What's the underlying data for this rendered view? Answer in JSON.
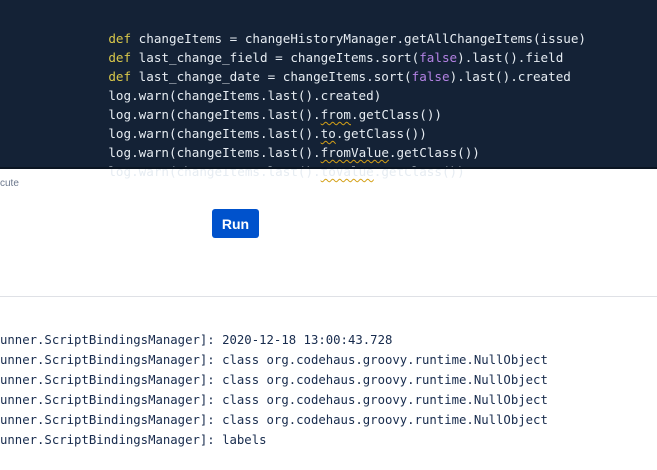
{
  "editor": {
    "lines": [
      [
        {
          "t": "def",
          "c": "kw"
        },
        {
          "t": " changeItems = changeHistoryManager.getAllChangeItems(issue)"
        }
      ],
      [
        {
          "t": "def",
          "c": "kw"
        },
        {
          "t": " last_change_field = changeItems.sort("
        },
        {
          "t": "false",
          "c": "lit"
        },
        {
          "t": ").last().field"
        }
      ],
      [
        {
          "t": "def",
          "c": "kw"
        },
        {
          "t": " last_change_date = changeItems.sort("
        },
        {
          "t": "false",
          "c": "lit"
        },
        {
          "t": ").last().created"
        }
      ],
      [
        {
          "t": "log.warn(changeItems.last().created)"
        }
      ],
      [
        {
          "t": "log.warn(changeItems.last()."
        },
        {
          "t": "from",
          "c": "squig"
        },
        {
          "t": ".getClass())"
        }
      ],
      [
        {
          "t": "log.warn(changeItems.last()."
        },
        {
          "t": "to",
          "c": "squig"
        },
        {
          "t": ".getClass())"
        }
      ],
      [
        {
          "t": "log.warn(changeItems.last()."
        },
        {
          "t": "fromValue",
          "c": "squig"
        },
        {
          "t": ".getClass())"
        }
      ],
      [
        {
          "t": "log.warn(changeItems.last()."
        },
        {
          "t": "toValue",
          "c": "squig"
        },
        {
          "t": ".getClass())"
        }
      ]
    ]
  },
  "hint": {
    "text": "cute"
  },
  "run_button": {
    "label": "Run"
  },
  "log": {
    "lines": [
      "unner.ScriptBindingsManager]: 2020-12-18 13:00:43.728",
      "unner.ScriptBindingsManager]: class org.codehaus.groovy.runtime.NullObject",
      "unner.ScriptBindingsManager]: class org.codehaus.groovy.runtime.NullObject",
      "unner.ScriptBindingsManager]: class org.codehaus.groovy.runtime.NullObject",
      "unner.ScriptBindingsManager]: class org.codehaus.groovy.runtime.NullObject",
      "unner.ScriptBindingsManager]: labels"
    ]
  },
  "colors": {
    "editor_background": "#142236",
    "keyword": "#d9c84a",
    "literal": "#b382e3",
    "run_button": "#0052cc"
  }
}
